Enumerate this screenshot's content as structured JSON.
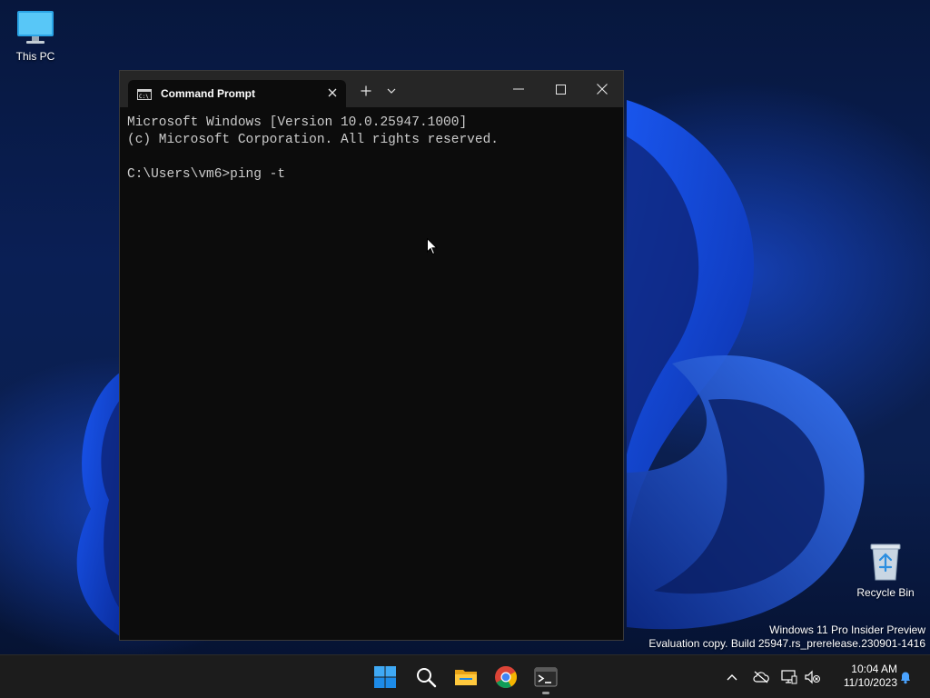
{
  "desktop": {
    "icons": [
      {
        "label": "This PC",
        "icon": "computer-icon"
      },
      {
        "label": "Recycle Bin",
        "icon": "recycle-bin-icon"
      }
    ],
    "watermark": {
      "line1": "Windows 11 Pro Insider Preview",
      "line2": "Evaluation copy. Build 25947.rs_prerelease.230901-1416"
    }
  },
  "window": {
    "tab_title": "Command Prompt",
    "tab_icon": "cmd-icon",
    "console_lines": [
      "Microsoft Windows [Version 10.0.25947.1000]",
      "(c) Microsoft Corporation. All rights reserved.",
      "",
      "C:\\Users\\vm6>ping -t"
    ]
  },
  "taskbar": {
    "apps": [
      "start-icon",
      "search-icon",
      "file-explorer-icon",
      "chrome-icon",
      "terminal-icon"
    ],
    "clock": {
      "time": "10:04 AM",
      "date": "11/10/2023"
    }
  },
  "colors": {
    "console_bg": "#0c0c0c",
    "console_fg": "#cccccc",
    "titlebar_bg": "#262626",
    "taskbar_bg": "#1c1c1c",
    "accent": "#0078d4"
  }
}
